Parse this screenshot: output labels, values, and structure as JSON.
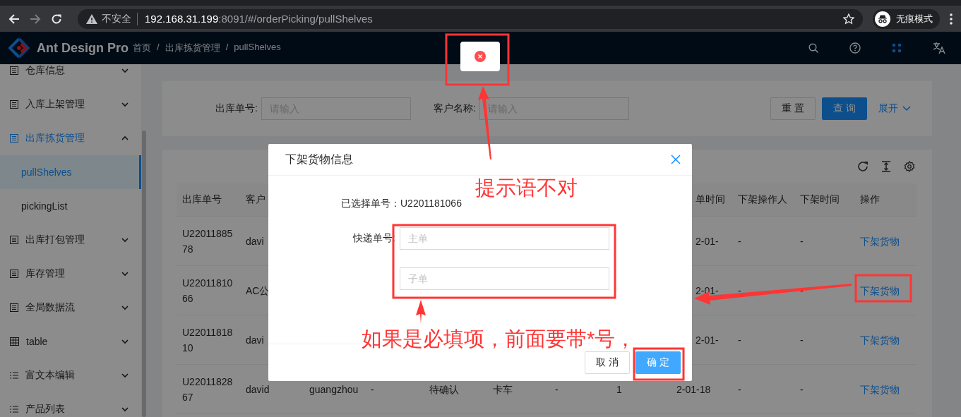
{
  "browser": {
    "security_label": "不安全",
    "url_host": "192.168.31.199",
    "url_rest": ":8091/#/orderPicking/pullShelves",
    "profile_label": "无痕模式"
  },
  "header": {
    "title": "Ant Design Pro",
    "breadcrumb": [
      "首页",
      "/",
      "出库拣货管理",
      "/",
      "pullShelves"
    ]
  },
  "sidebar": {
    "items": [
      {
        "label": "仓库信息",
        "kind": "form",
        "expanded": false
      },
      {
        "label": "入库上架管理",
        "kind": "form",
        "expanded": false
      },
      {
        "label": "出库拣货管理",
        "kind": "form",
        "expanded": true,
        "children": [
          {
            "label": "pullShelves",
            "selected": true
          },
          {
            "label": "pickingList",
            "selected": false
          }
        ]
      },
      {
        "label": "出库打包管理",
        "kind": "form",
        "expanded": false
      },
      {
        "label": "库存管理",
        "kind": "form",
        "expanded": false
      },
      {
        "label": "全局数据流",
        "kind": "form",
        "expanded": false
      },
      {
        "label": "table",
        "kind": "table",
        "expanded": false
      },
      {
        "label": "富文本编辑",
        "kind": "list",
        "expanded": false
      },
      {
        "label": "产品列表",
        "kind": "list",
        "expanded": false
      }
    ]
  },
  "search_form": {
    "fields": [
      {
        "label": "出库单号:",
        "placeholder": "请输入"
      },
      {
        "label": "客户名称:",
        "placeholder": "请输入"
      }
    ],
    "buttons": [
      {
        "label": "重 置",
        "kind": "default"
      },
      {
        "label": "查 询",
        "kind": "primary"
      }
    ],
    "expand_link": "展开"
  },
  "table": {
    "header": {
      "left": [
        "出库单号",
        "客户"
      ],
      "right": [
        "单时间",
        "下架操作人",
        "下架时间",
        "操作"
      ]
    },
    "rows": [
      {
        "left": [
          "U2201188578",
          "davi"
        ],
        "right": [
          "2-01-",
          "-",
          "-"
        ],
        "action": "下架货物"
      },
      {
        "left": [
          "U2201181066",
          "AC公"
        ],
        "right": [
          "2-01-",
          "-",
          "-"
        ],
        "action": "下架货物"
      },
      {
        "left": [
          "U2201181810",
          "davi"
        ],
        "right": [
          "2-01-",
          "-",
          "-"
        ],
        "action": "下架货物"
      },
      {
        "left": [
          "U2201182867",
          "david"
        ],
        "middle": [
          "guangzhou",
          "-",
          "待确认",
          "卡车",
          "-",
          "1"
        ],
        "right": [
          "2-01-18",
          "-",
          "-"
        ],
        "action": "下架货物"
      }
    ]
  },
  "message": {
    "kind": "error"
  },
  "modal": {
    "title": "下架货物信息",
    "summary": "已选择单号：U2201181066",
    "field_label": "快递单号:",
    "inputs": [
      {
        "placeholder": "主单"
      },
      {
        "placeholder": "子单"
      }
    ],
    "buttons": [
      {
        "label": "取 消",
        "kind": "default"
      },
      {
        "label": "确 定",
        "kind": "primary"
      }
    ]
  },
  "annotations": [
    {
      "text": "提示语不对"
    },
    {
      "text": "如果是必填项，前面要带*号，"
    }
  ]
}
